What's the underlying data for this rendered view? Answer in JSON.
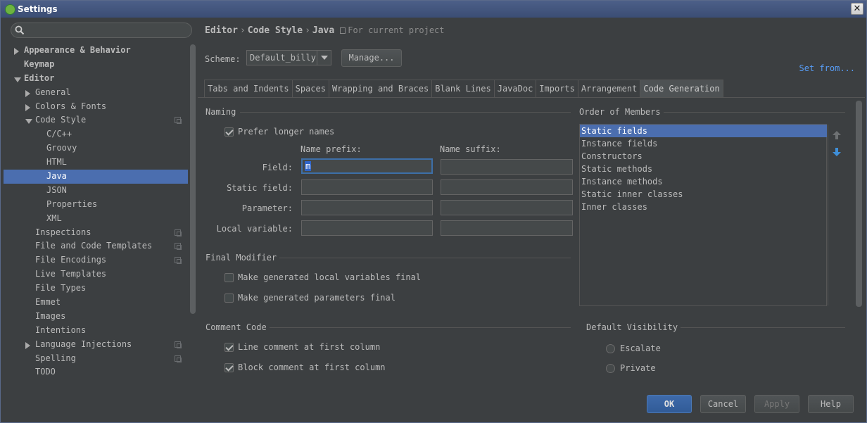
{
  "window": {
    "title": "Settings"
  },
  "sidebar": {
    "tree": [
      {
        "label": "Appearance & Behavior",
        "bold": true,
        "arrow": "right",
        "level": 0
      },
      {
        "label": "Keymap",
        "bold": true,
        "arrow": "",
        "level": 0
      },
      {
        "label": "Editor",
        "bold": true,
        "arrow": "down",
        "level": 0
      },
      {
        "label": "General",
        "arrow": "right",
        "level": 1
      },
      {
        "label": "Colors & Fonts",
        "arrow": "right",
        "level": 1
      },
      {
        "label": "Code Style",
        "arrow": "down",
        "level": 1,
        "copy": true
      },
      {
        "label": "C/C++",
        "level": 2
      },
      {
        "label": "Groovy",
        "level": 2
      },
      {
        "label": "HTML",
        "level": 2
      },
      {
        "label": "Java",
        "level": 2,
        "selected": true
      },
      {
        "label": "JSON",
        "level": 2
      },
      {
        "label": "Properties",
        "level": 2
      },
      {
        "label": "XML",
        "level": 2
      },
      {
        "label": "Inspections",
        "level": 1,
        "copy": true
      },
      {
        "label": "File and Code Templates",
        "level": 1,
        "copy": true
      },
      {
        "label": "File Encodings",
        "level": 1,
        "copy": true
      },
      {
        "label": "Live Templates",
        "level": 1
      },
      {
        "label": "File Types",
        "level": 1
      },
      {
        "label": "Emmet",
        "level": 1
      },
      {
        "label": "Images",
        "level": 1
      },
      {
        "label": "Intentions",
        "level": 1
      },
      {
        "label": "Language Injections",
        "arrow": "right",
        "level": 1,
        "copy": true
      },
      {
        "label": "Spelling",
        "level": 1,
        "copy": true
      },
      {
        "label": "TODO",
        "level": 1
      }
    ]
  },
  "breadcrumb": {
    "p1": "Editor",
    "sep": "›",
    "p2": "Code Style",
    "p3": "Java",
    "note": "For current project"
  },
  "scheme": {
    "label": "Scheme:",
    "value": "Default_billy",
    "manage": "Manage...",
    "set_from": "Set from..."
  },
  "tabs": [
    "Tabs and Indents",
    "Spaces",
    "Wrapping and Braces",
    "Blank Lines",
    "JavaDoc",
    "Imports",
    "Arrangement",
    "Code Generation"
  ],
  "naming": {
    "title": "Naming",
    "prefer_longer": "Prefer longer names",
    "prefix_header": "Name prefix:",
    "suffix_header": "Name suffix:",
    "rows": {
      "field": {
        "label": "Field:",
        "prefix": "m",
        "suffix": ""
      },
      "static_field": {
        "label": "Static field:",
        "prefix": "",
        "suffix": ""
      },
      "parameter": {
        "label": "Parameter:",
        "prefix": "",
        "suffix": ""
      },
      "local_variable": {
        "label": "Local variable:",
        "prefix": "",
        "suffix": ""
      }
    }
  },
  "final_modifier": {
    "title": "Final Modifier",
    "local_vars": "Make generated local variables final",
    "params": "Make generated parameters final"
  },
  "comment_code": {
    "title": "Comment Code",
    "line_comment": "Line comment at first column",
    "block_comment": "Block comment at first column"
  },
  "order": {
    "title": "Order of Members",
    "items": [
      "Static fields",
      "Instance fields",
      "Constructors",
      "Static methods",
      "Instance methods",
      "Static inner classes",
      "Inner classes"
    ]
  },
  "visibility": {
    "title": "Default Visibility",
    "escalate": "Escalate",
    "private": "Private"
  },
  "footer": {
    "ok": "OK",
    "cancel": "Cancel",
    "apply": "Apply",
    "help": "Help"
  },
  "colors": {
    "selection": "#4b6eaf",
    "link": "#589df6",
    "background": "#3c3f41"
  }
}
